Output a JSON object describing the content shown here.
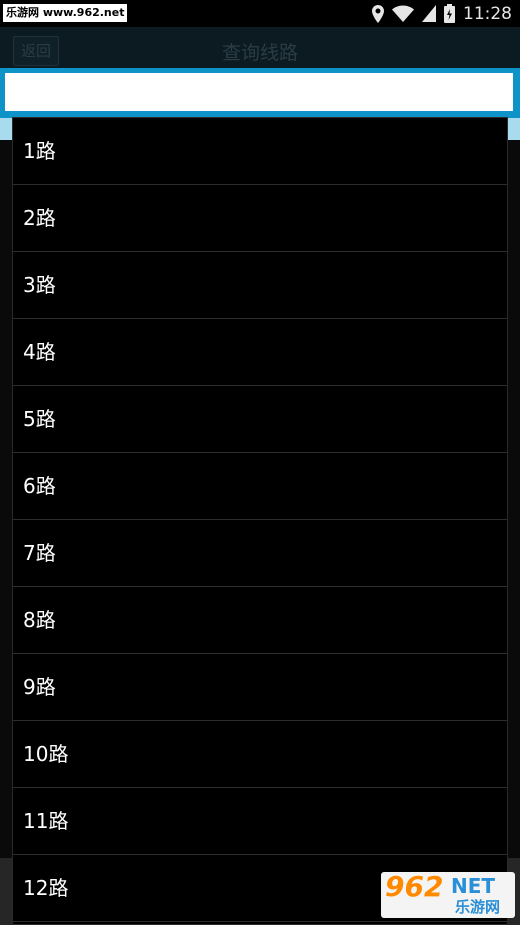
{
  "status_bar": {
    "watermark_text": "乐游网 www.962.net",
    "time": "11:28",
    "icons": [
      "location-icon",
      "wifi-icon",
      "signal-icon",
      "battery-icon"
    ]
  },
  "header": {
    "back_label": "返回",
    "title": "查询线路"
  },
  "search": {
    "value": "",
    "placeholder": ""
  },
  "dropdown": {
    "items": [
      "1路",
      "2路",
      "3路",
      "4路",
      "5路",
      "6路",
      "7路",
      "8路",
      "9路",
      "10路",
      "11路",
      "12路"
    ]
  },
  "watermark": {
    "number": "962",
    "suffix": "NET",
    "cn_name": "乐游网"
  },
  "colors": {
    "accent": "#0e93c8",
    "watermark_orange": "#ff8a00",
    "watermark_blue": "#2a8fd6"
  }
}
